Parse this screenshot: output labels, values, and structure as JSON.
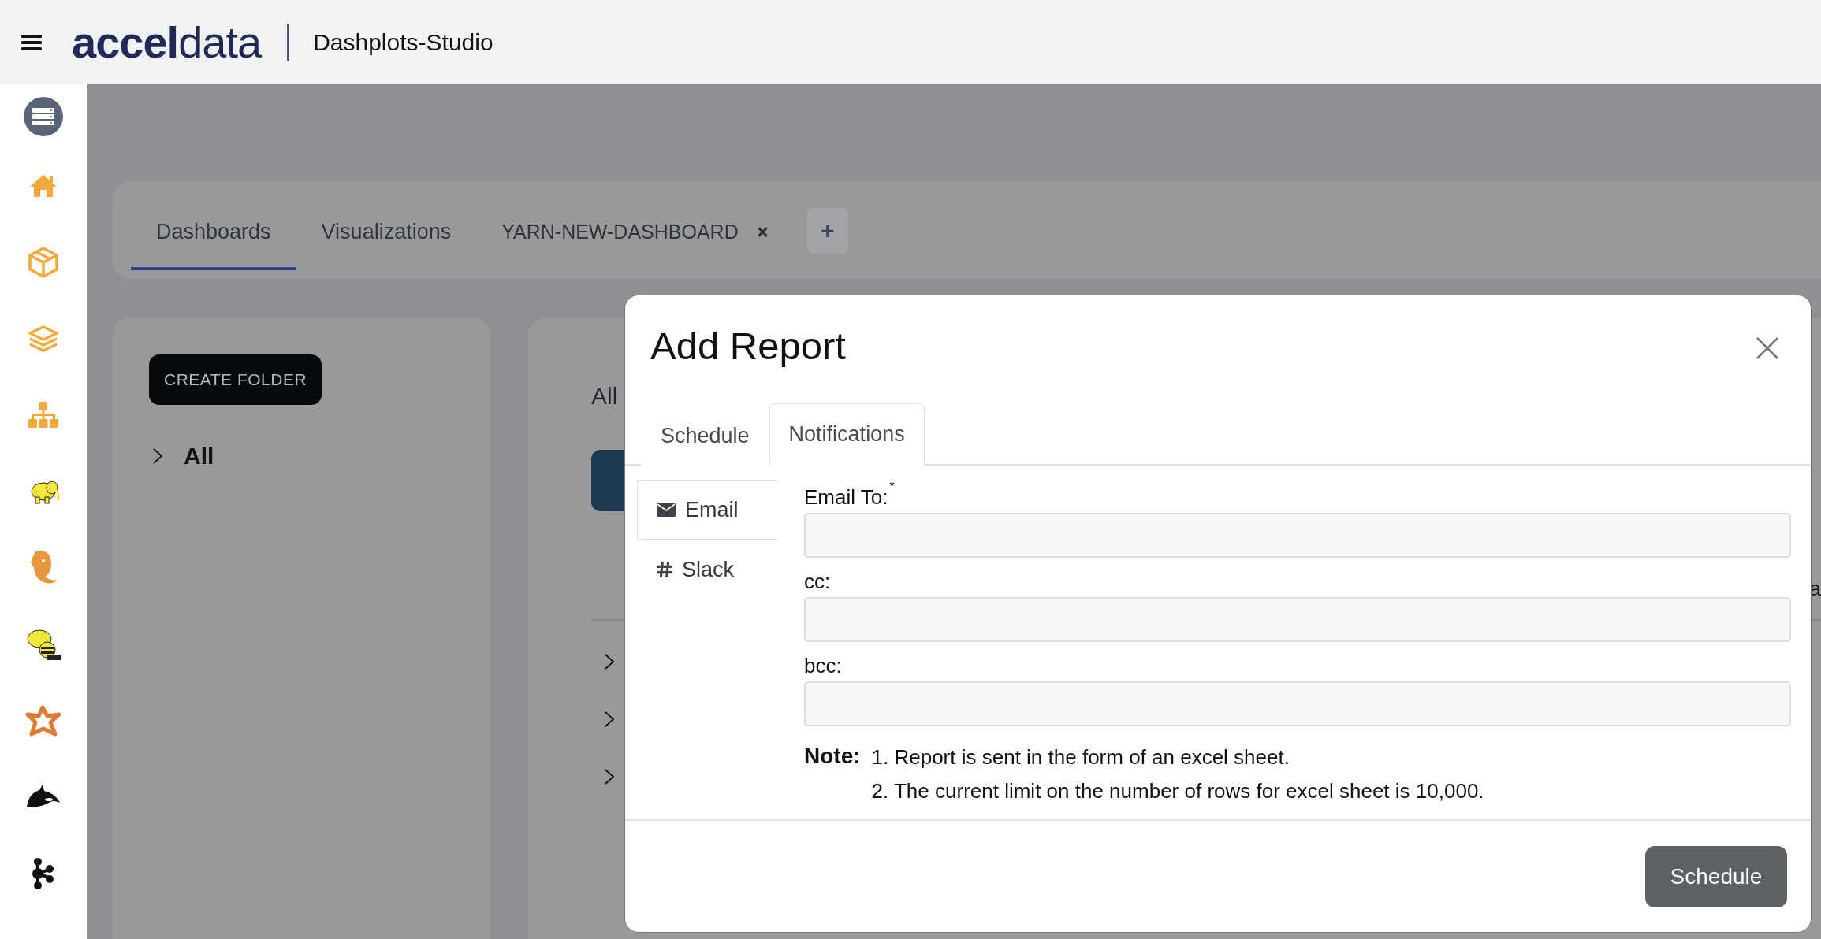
{
  "header": {
    "logo": "**accel**data",
    "app_title": "Dashplots-Studio"
  },
  "sidebar": {
    "items": [
      {
        "kind": "server",
        "selected": true
      },
      {
        "kind": "home",
        "selected": false
      },
      {
        "kind": "box",
        "selected": false
      },
      {
        "kind": "layers",
        "selected": false
      },
      {
        "kind": "hierarchy",
        "selected": false
      },
      {
        "kind": "elephant",
        "selected": false
      },
      {
        "kind": "elephant-head",
        "selected": false
      },
      {
        "kind": "bee-elephant",
        "selected": false
      },
      {
        "kind": "star",
        "selected": false
      },
      {
        "kind": "whale",
        "selected": false
      },
      {
        "kind": "nodes",
        "selected": false
      }
    ]
  },
  "tabs": [
    {
      "label": "Dashboards",
      "selected": true,
      "closable": false
    },
    {
      "label": "Visualizations",
      "selected": false,
      "closable": false
    },
    {
      "label": "YARN-NEW-DASHBOARD",
      "selected": false,
      "closable": true
    }
  ],
  "add_tab_button": "+",
  "folders": {
    "create_button": "CREATE FOLDER",
    "tree": [
      {
        "label": "All",
        "expanded": false
      }
    ]
  },
  "main_panel": {
    "heading": "All",
    "column_1": "a",
    "rows": [
      {
        "expanded": false
      },
      {
        "expanded": false
      },
      {
        "expanded": false
      }
    ]
  },
  "dialog": {
    "title": "Add Report",
    "tabs": [
      {
        "label": "Schedule",
        "selected": false
      },
      {
        "label": "Notifications",
        "selected": true
      }
    ],
    "channels": [
      {
        "kind": "email",
        "label": "Email",
        "selected": true
      },
      {
        "kind": "slack",
        "label": "Slack",
        "selected": false
      }
    ],
    "fields": [
      {
        "label": "Email To:",
        "required_mark": "*"
      },
      {
        "label": "cc:"
      },
      {
        "label": "bcc:"
      }
    ],
    "note": {
      "label": "Note:",
      "lines": [
        "1. Report is sent in the form of an excel sheet.",
        "2. The current limit on the number of rows for excel sheet is 10,000."
      ]
    },
    "submit_button": "Schedule"
  }
}
